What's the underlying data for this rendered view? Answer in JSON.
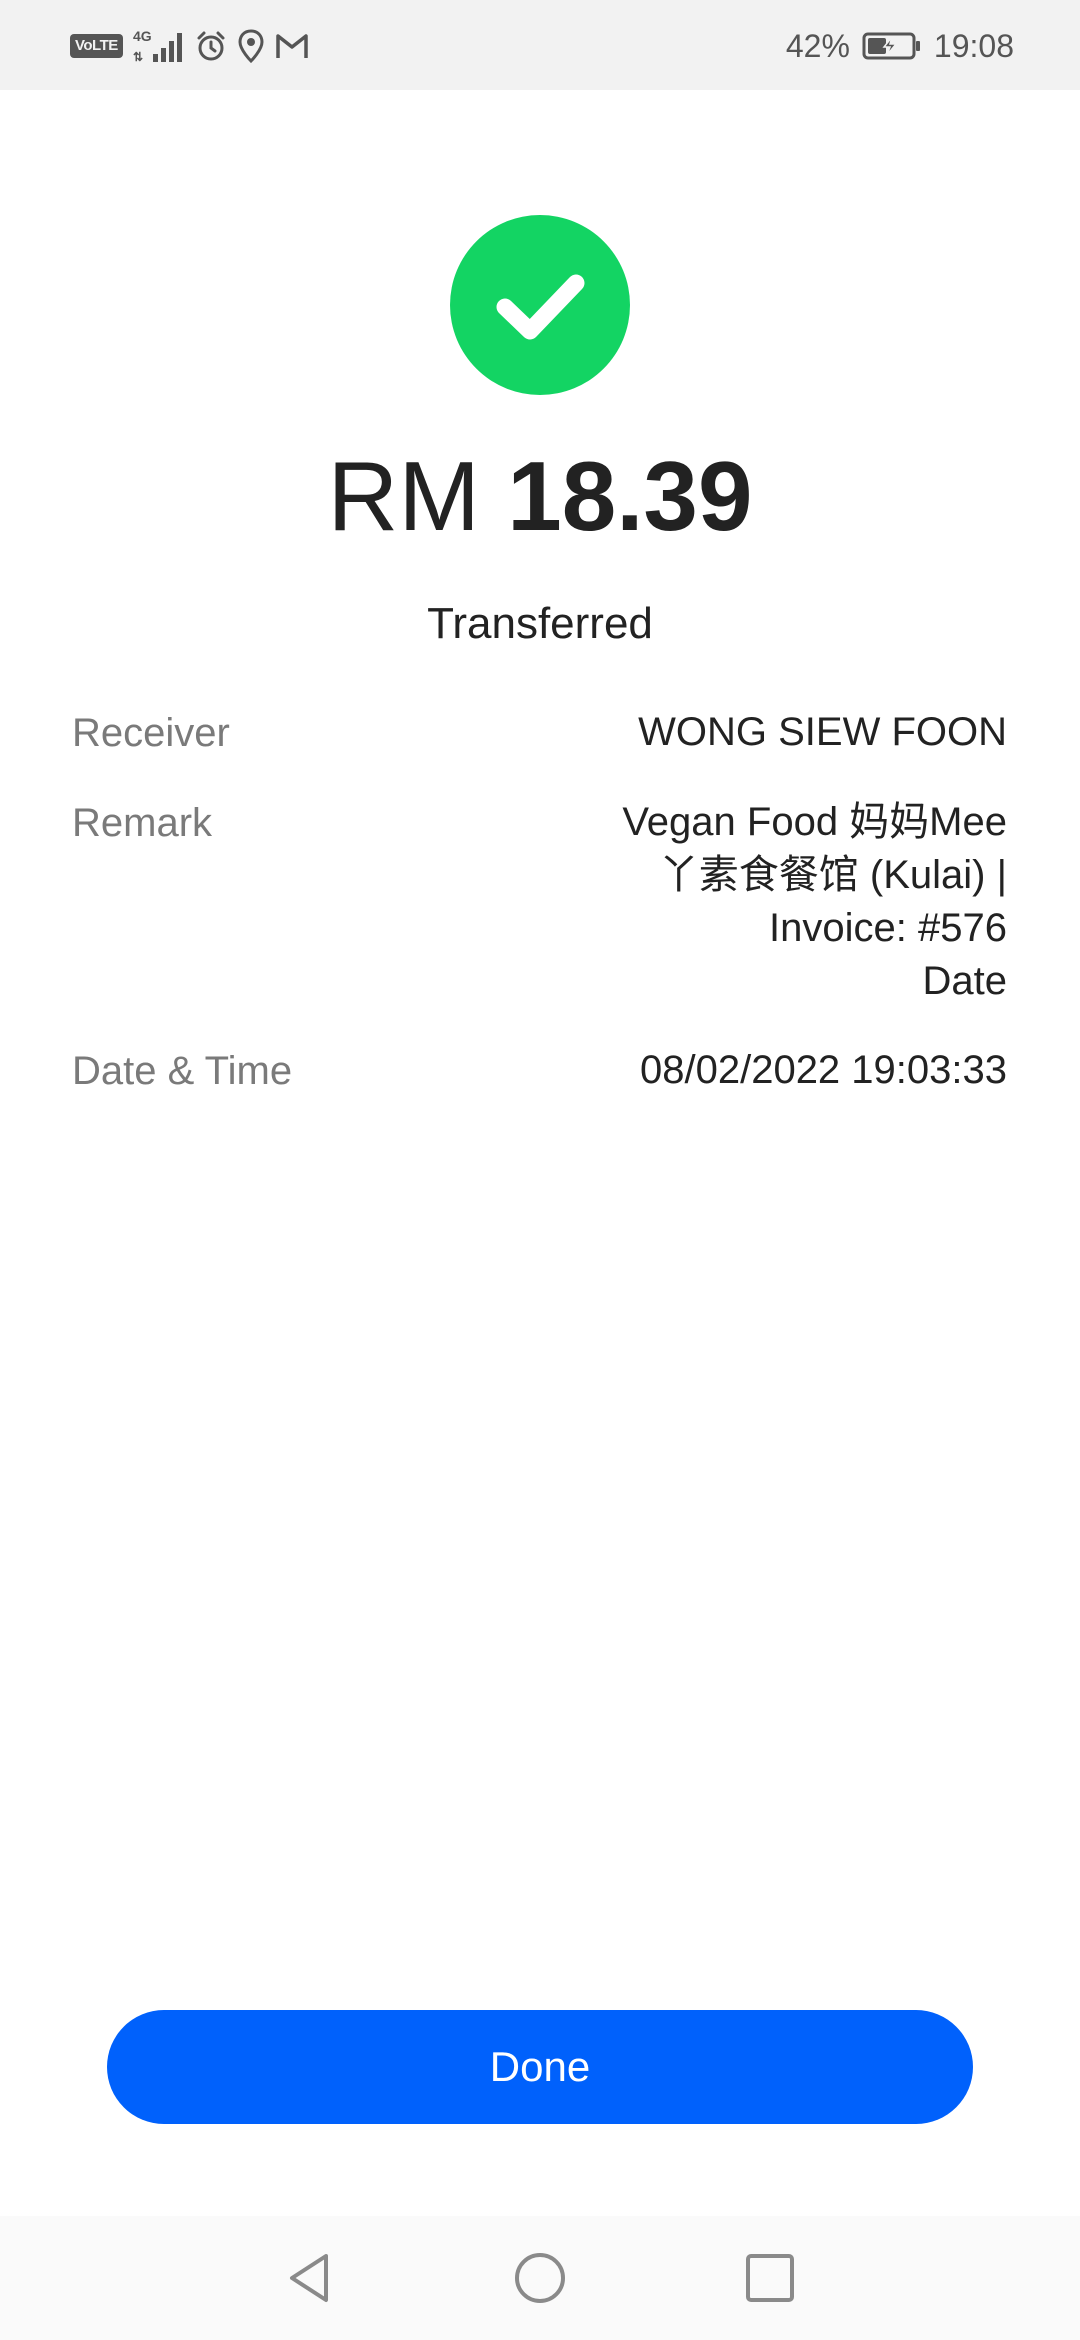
{
  "status_bar": {
    "network_badge": "VoLTE",
    "network_type": "4G",
    "icons": [
      "volte-icon",
      "signal-icon",
      "alarm-icon",
      "location-icon",
      "gmail-icon"
    ],
    "battery_percent": "42%",
    "battery_level": 0.42,
    "time": "19:08"
  },
  "success": {
    "icon": "check-circle-icon",
    "color": "#13d463"
  },
  "amount": {
    "currency": "RM",
    "value": "18.39"
  },
  "status_label": "Transferred",
  "details": {
    "receiver": {
      "label": "Receiver",
      "value": "WONG SIEW FOON"
    },
    "remark": {
      "label": "Remark",
      "lines": [
        "Vegan Food 妈妈Mee",
        "丫素食餐馆 (Kulai) |",
        "Invoice: #576",
        "Date"
      ]
    },
    "date_time": {
      "label": "Date & Time",
      "value": "08/02/2022 19:03:33"
    }
  },
  "done_button": {
    "label": "Done",
    "color": "#0061fc"
  },
  "nav_bar": {
    "buttons": [
      "back-icon",
      "home-icon",
      "recents-icon"
    ]
  }
}
